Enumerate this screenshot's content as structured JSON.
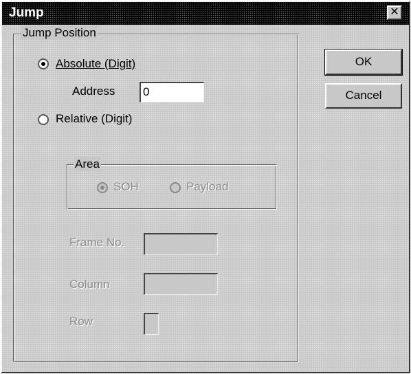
{
  "window": {
    "title": "Jump",
    "close_icon": "close-icon"
  },
  "jump_position": {
    "group_label": "Jump Position",
    "absolute": {
      "label": "Absolute (Digit)",
      "selected": true
    },
    "address": {
      "label": "Address",
      "value": "0"
    },
    "relative": {
      "label": "Relative (Digit)",
      "selected": false
    },
    "area": {
      "group_label": "Area",
      "options": [
        {
          "label": "SOH",
          "selected": true,
          "enabled": false
        },
        {
          "label": "Payload",
          "selected": false,
          "enabled": false
        }
      ]
    },
    "frame_no": {
      "label": "Frame No.",
      "value": ""
    },
    "column": {
      "label": "Column",
      "value": ""
    },
    "row": {
      "label": "Row",
      "value": ""
    }
  },
  "buttons": {
    "ok": "OK",
    "cancel": "Cancel"
  }
}
